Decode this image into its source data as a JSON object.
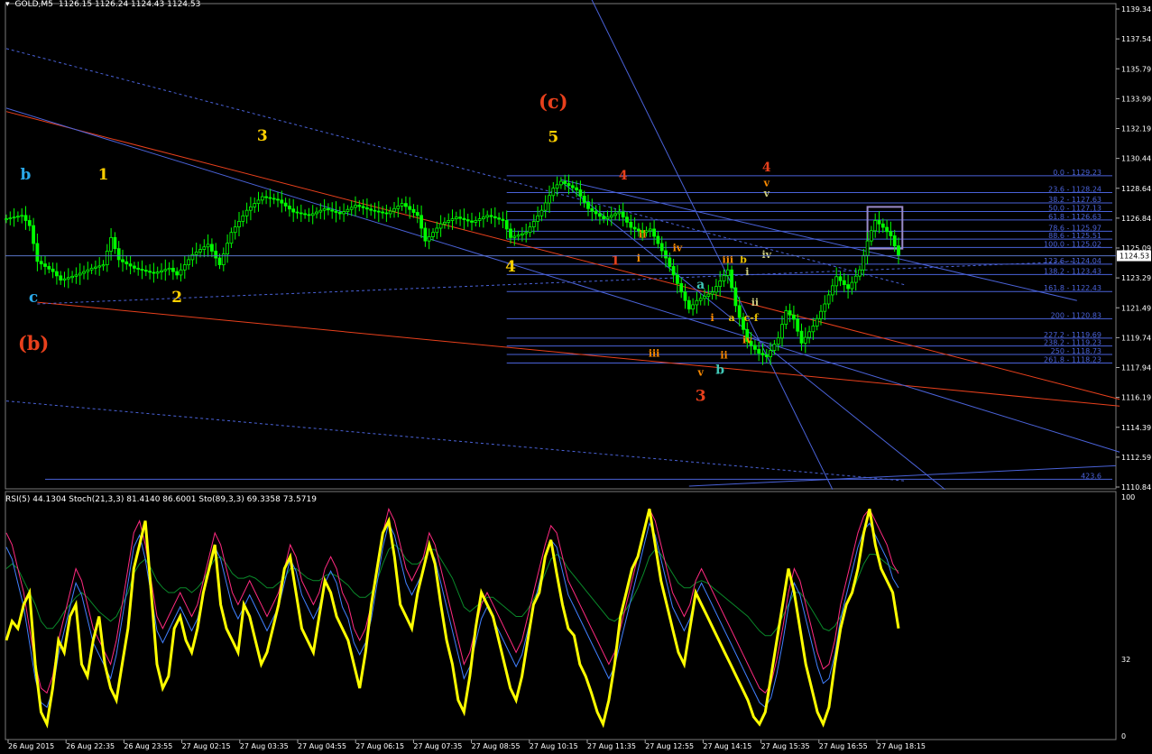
{
  "header": {
    "symbol": "GOLD,M5",
    "ohlc": "1126.15 1126.24 1124.43 1124.53"
  },
  "indicator_header": "RSI(5) 44.1304  Stoch(21,3,3) 81.4140 86.6001  Sto(89,3,3) 69.3358 73.5719",
  "current_price_label": "1124.53",
  "colors": {
    "background": "#000000",
    "candle": "#00ff00",
    "fib_line": "#4a62d8",
    "channel_red": "#e8401c",
    "trend_blue": "#4a62d8",
    "rsi": "#ffff00",
    "stoch_fast": "#ff2a80",
    "stoch_signal": "#4080ff",
    "sto_slow": "#0a8a2a",
    "box": "#9a8ac8"
  },
  "chart_data": [
    {
      "type": "candlestick",
      "title": "GOLD,M5",
      "y_ticks": [
        "1139.34",
        "1137.54",
        "1135.79",
        "1133.99",
        "1132.19",
        "1130.44",
        "1128.64",
        "1126.84",
        "1125.09",
        "1123.29",
        "1121.49",
        "1119.74",
        "1117.94",
        "1116.19",
        "1114.39",
        "1112.59",
        "1110.84"
      ],
      "ylim": [
        1110.84,
        1139.34
      ],
      "x_ticks": [
        "26 Aug 2015",
        "26 Aug 22:35",
        "26 Aug 23:55",
        "27 Aug 02:15",
        "27 Aug 03:35",
        "27 Aug 04:55",
        "27 Aug 06:15",
        "27 Aug 07:35",
        "27 Aug 08:55",
        "27 Aug 10:15",
        "27 Aug 11:35",
        "27 Aug 12:55",
        "27 Aug 14:15",
        "27 Aug 15:35",
        "27 Aug 16:55",
        "27 Aug 18:15"
      ],
      "price_path": [
        [
          0,
          1126.7
        ],
        [
          4,
          1126.9
        ],
        [
          6,
          1126.3
        ],
        [
          8,
          1124.2
        ],
        [
          12,
          1123.6
        ],
        [
          14,
          1123.1
        ],
        [
          18,
          1123.4
        ],
        [
          22,
          1123.8
        ],
        [
          25,
          1124.0
        ],
        [
          27,
          1125.6
        ],
        [
          29,
          1124.3
        ],
        [
          33,
          1123.8
        ],
        [
          38,
          1123.5
        ],
        [
          42,
          1123.8
        ],
        [
          44,
          1123.4
        ],
        [
          48,
          1124.6
        ],
        [
          52,
          1125.2
        ],
        [
          55,
          1124.0
        ],
        [
          58,
          1125.9
        ],
        [
          62,
          1127.2
        ],
        [
          66,
          1128.0
        ],
        [
          70,
          1127.8
        ],
        [
          74,
          1127.1
        ],
        [
          78,
          1126.9
        ],
        [
          82,
          1127.3
        ],
        [
          86,
          1127.0
        ],
        [
          90,
          1127.5
        ],
        [
          94,
          1127.2
        ],
        [
          98,
          1127.0
        ],
        [
          102,
          1127.6
        ],
        [
          106,
          1126.9
        ],
        [
          108,
          1125.4
        ],
        [
          112,
          1126.4
        ],
        [
          116,
          1126.8
        ],
        [
          120,
          1126.5
        ],
        [
          124,
          1126.9
        ],
        [
          128,
          1126.6
        ],
        [
          130,
          1125.6
        ],
        [
          134,
          1125.9
        ],
        [
          138,
          1127.2
        ],
        [
          141,
          1128.5
        ],
        [
          143,
          1128.9
        ],
        [
          147,
          1128.4
        ],
        [
          150,
          1127.3
        ],
        [
          154,
          1126.7
        ],
        [
          158,
          1127.1
        ],
        [
          161,
          1126.2
        ],
        [
          164,
          1125.9
        ],
        [
          166,
          1126.1
        ],
        [
          170,
          1124.4
        ],
        [
          173,
          1122.9
        ],
        [
          176,
          1121.4
        ],
        [
          178,
          1121.9
        ],
        [
          182,
          1122.4
        ],
        [
          186,
          1123.7
        ],
        [
          188,
          1121.6
        ],
        [
          191,
          1119.5
        ],
        [
          194,
          1118.8
        ],
        [
          196,
          1118.6
        ],
        [
          199,
          1119.7
        ],
        [
          201,
          1121.3
        ],
        [
          203,
          1120.8
        ],
        [
          205,
          1119.4
        ],
        [
          208,
          1120.4
        ],
        [
          211,
          1121.7
        ],
        [
          214,
          1123.3
        ],
        [
          217,
          1122.6
        ],
        [
          220,
          1123.7
        ],
        [
          222,
          1125.4
        ],
        [
          224,
          1126.6
        ],
        [
          226,
          1126.2
        ],
        [
          228,
          1125.7
        ],
        [
          230,
          1124.53
        ]
      ],
      "fib_levels": [
        {
          "label": "0.0 - 1129.23",
          "price": 1129.23
        },
        {
          "label": "23.6 - 1128.24",
          "price": 1128.24
        },
        {
          "label": "38.2 - 1127.63",
          "price": 1127.63
        },
        {
          "label": "50.0 - 1127.13",
          "price": 1127.13
        },
        {
          "label": "61.8 - 1126.63",
          "price": 1126.63
        },
        {
          "label": "78.6 - 1125.97",
          "price": 1125.97
        },
        {
          "label": "88.6 - 1125.51",
          "price": 1125.51
        },
        {
          "label": "100.0 - 1125.02",
          "price": 1125.02
        },
        {
          "label": "123.6 - 1124.04",
          "price": 1124.04
        },
        {
          "label": "138.2 - 1123.43",
          "price": 1123.43
        },
        {
          "label": "161.8 - 1122.43",
          "price": 1122.43
        },
        {
          "label": "200 - 1120.83",
          "price": 1120.83
        },
        {
          "label": "227.2 - 1119.69",
          "price": 1119.69
        },
        {
          "label": "238.2 - 1119.23",
          "price": 1119.23
        },
        {
          "label": "250 - 1118.73",
          "price": 1118.73
        },
        {
          "label": "261.8 - 1118.23",
          "price": 1118.23
        },
        {
          "label": "423.6",
          "price": 1111.4
        }
      ],
      "wave_labels": [
        {
          "text": "b",
          "bar": 5,
          "price": 1129.0,
          "color": "#2aa8e8",
          "size": "l"
        },
        {
          "text": "c",
          "bar": 7,
          "price": 1121.8,
          "color": "#2aa8e8",
          "size": "l"
        },
        {
          "text": "(b)",
          "bar": 7,
          "price": 1119.0,
          "color": "#e8401c",
          "size": "xl"
        },
        {
          "text": "1",
          "bar": 25,
          "price": 1129.0,
          "color": "#ffd000",
          "size": "l"
        },
        {
          "text": "2",
          "bar": 44,
          "price": 1121.8,
          "color": "#ffd000",
          "size": "l"
        },
        {
          "text": "3",
          "bar": 66,
          "price": 1131.3,
          "color": "#ffd000",
          "size": "l"
        },
        {
          "text": "4",
          "bar": 130,
          "price": 1123.6,
          "color": "#ffd000",
          "size": "l"
        },
        {
          "text": "5",
          "bar": 141,
          "price": 1131.2,
          "color": "#ffd000",
          "size": "l"
        },
        {
          "text": "(c)",
          "bar": 141,
          "price": 1133.2,
          "color": "#e8401c",
          "size": "xl"
        },
        {
          "text": "4",
          "bar": 159,
          "price": 1129.0,
          "color": "#e8401c",
          "size": "m"
        },
        {
          "text": "ii",
          "bar": 164,
          "price": 1125.6,
          "color": "#ff8c00",
          "size": "s"
        },
        {
          "text": "1",
          "bar": 157,
          "price": 1124.0,
          "color": "#e8401c",
          "size": "m"
        },
        {
          "text": "i",
          "bar": 163,
          "price": 1124.2,
          "color": "#ff8c00",
          "size": "s"
        },
        {
          "text": "iv",
          "bar": 173,
          "price": 1124.8,
          "color": "#ff8c00",
          "size": "s"
        },
        {
          "text": "iii",
          "bar": 167,
          "price": 1118.6,
          "color": "#ff8c00",
          "size": "s"
        },
        {
          "text": "a",
          "bar": 179,
          "price": 1122.6,
          "color": "#40c8b8",
          "size": "m"
        },
        {
          "text": "v",
          "bar": 179,
          "price": 1117.5,
          "color": "#ff8c00",
          "size": "s"
        },
        {
          "text": "b",
          "bar": 184,
          "price": 1117.6,
          "color": "#40c8b8",
          "size": "m"
        },
        {
          "text": "3",
          "bar": 179,
          "price": 1116.0,
          "color": "#e8401c",
          "size": "l"
        },
        {
          "text": "i",
          "bar": 182,
          "price": 1120.7,
          "color": "#ff8c00",
          "size": "s"
        },
        {
          "text": "ii",
          "bar": 185,
          "price": 1118.5,
          "color": "#ff8c00",
          "size": "s"
        },
        {
          "text": "iii",
          "bar": 186,
          "price": 1124.1,
          "color": "#ff8c00",
          "size": "s"
        },
        {
          "text": "iv",
          "bar": 191,
          "price": 1119.4,
          "color": "#ff8c00",
          "size": "s"
        },
        {
          "text": "a",
          "bar": 187,
          "price": 1120.7,
          "color": "#e8c000",
          "size": "s"
        },
        {
          "text": "c-f",
          "bar": 192,
          "price": 1120.7,
          "color": "#e8c000",
          "size": "s"
        },
        {
          "text": "b",
          "bar": 190,
          "price": 1124.1,
          "color": "#e8c000",
          "size": "s"
        },
        {
          "text": "i",
          "bar": 191,
          "price": 1123.4,
          "color": "#cccc80",
          "size": "s"
        },
        {
          "text": "ii",
          "bar": 193,
          "price": 1121.6,
          "color": "#cccc80",
          "size": "s"
        },
        {
          "text": "iv",
          "bar": 196,
          "price": 1124.4,
          "color": "#cccc80",
          "size": "s"
        },
        {
          "text": "v",
          "bar": 196,
          "price": 1128.6,
          "color": "#ff8c00",
          "size": "s"
        },
        {
          "text": "v",
          "bar": 196,
          "price": 1128.0,
          "color": "#cccc80",
          "size": "s"
        },
        {
          "text": "4",
          "bar": 196,
          "price": 1129.5,
          "color": "#e8401c",
          "size": "m"
        }
      ]
    },
    {
      "type": "line",
      "title": "RSI(5) 44.1304  Stoch(21,3,3) 81.4140 86.6001  Sto(89,3,3) 69.3358 73.5719",
      "y_ticks": [
        "100",
        "32",
        "0"
      ],
      "ylim": [
        0,
        100
      ],
      "series": [
        {
          "name": "RSI(5) 44.1304",
          "values": [
            40,
            48,
            45,
            55,
            60,
            30,
            10,
            5,
            20,
            40,
            35,
            50,
            55,
            30,
            25,
            40,
            50,
            30,
            20,
            15,
            30,
            45,
            70,
            80,
            90,
            60,
            30,
            20,
            25,
            45,
            50,
            40,
            35,
            45,
            60,
            70,
            80,
            55,
            45,
            40,
            35,
            55,
            50,
            40,
            30,
            35,
            45,
            55,
            70,
            75,
            60,
            45,
            40,
            35,
            50,
            65,
            60,
            50,
            45,
            40,
            30,
            20,
            35,
            55,
            70,
            85,
            90,
            75,
            55,
            50,
            45,
            60,
            70,
            80,
            72,
            55,
            40,
            30,
            15,
            10,
            25,
            45,
            60,
            55,
            50,
            40,
            30,
            20,
            15,
            25,
            40,
            55,
            60,
            75,
            82,
            68,
            55,
            45,
            42,
            30,
            25,
            18,
            10,
            5,
            15,
            30,
            50,
            60,
            70,
            75,
            85,
            95,
            80,
            65,
            55,
            45,
            35,
            30,
            45,
            60,
            55,
            50,
            45,
            40,
            35,
            30,
            25,
            20,
            15,
            8,
            5,
            10,
            25,
            40,
            55,
            70,
            60,
            45,
            30,
            20,
            10,
            5,
            12,
            30,
            45,
            55,
            60,
            70,
            85,
            95,
            80,
            70,
            65,
            60,
            45
          ]
        },
        {
          "name": "Stoch(21,3,3)",
          "values": [
            85,
            80,
            70,
            60,
            45,
            30,
            20,
            18,
            25,
            40,
            50,
            60,
            70,
            65,
            55,
            45,
            40,
            35,
            30,
            40,
            55,
            70,
            85,
            90,
            80,
            65,
            50,
            45,
            50,
            55,
            60,
            55,
            50,
            55,
            65,
            75,
            85,
            80,
            70,
            60,
            55,
            60,
            65,
            60,
            55,
            50,
            55,
            60,
            70,
            80,
            75,
            65,
            60,
            55,
            60,
            70,
            75,
            70,
            60,
            55,
            45,
            40,
            45,
            55,
            70,
            85,
            95,
            90,
            80,
            70,
            65,
            70,
            75,
            85,
            80,
            70,
            60,
            50,
            40,
            30,
            35,
            45,
            55,
            60,
            55,
            50,
            45,
            40,
            35,
            40,
            50,
            60,
            70,
            80,
            88,
            85,
            75,
            65,
            60,
            55,
            50,
            45,
            40,
            35,
            30,
            35,
            45,
            55,
            65,
            75,
            85,
            95,
            90,
            80,
            70,
            60,
            55,
            50,
            55,
            65,
            70,
            65,
            60,
            55,
            50,
            45,
            40,
            35,
            30,
            25,
            20,
            18,
            22,
            32,
            45,
            60,
            70,
            65,
            55,
            45,
            35,
            28,
            30,
            40,
            55,
            65,
            75,
            85,
            92,
            95,
            90,
            85,
            80,
            72,
            68
          ]
        },
        {
          "name": "Sto(89,3,3)",
          "values": [
            70,
            72,
            70,
            65,
            60,
            55,
            48,
            45,
            45,
            48,
            52,
            55,
            58,
            60,
            58,
            55,
            52,
            50,
            48,
            50,
            55,
            60,
            68,
            72,
            74,
            70,
            65,
            62,
            60,
            60,
            62,
            62,
            60,
            62,
            65,
            70,
            74,
            75,
            72,
            68,
            66,
            66,
            67,
            66,
            64,
            62,
            62,
            64,
            66,
            70,
            70,
            68,
            66,
            65,
            65,
            67,
            68,
            67,
            65,
            63,
            60,
            58,
            58,
            60,
            65,
            72,
            78,
            80,
            78,
            74,
            72,
            72,
            74,
            78,
            78,
            74,
            70,
            66,
            60,
            54,
            52,
            54,
            56,
            58,
            58,
            56,
            54,
            52,
            50,
            50,
            53,
            57,
            62,
            68,
            74,
            76,
            74,
            70,
            67,
            64,
            61,
            58,
            55,
            52,
            49,
            48,
            50,
            53,
            57,
            62,
            68,
            75,
            78,
            76,
            72,
            68,
            64,
            62,
            62,
            64,
            65,
            64,
            62,
            60,
            58,
            56,
            54,
            52,
            50,
            47,
            44,
            42,
            42,
            45,
            50,
            55,
            60,
            60,
            57,
            53,
            49,
            45,
            44,
            46,
            50,
            55,
            60,
            66,
            72,
            76,
            76,
            74,
            72,
            70,
            69
          ]
        }
      ]
    }
  ]
}
